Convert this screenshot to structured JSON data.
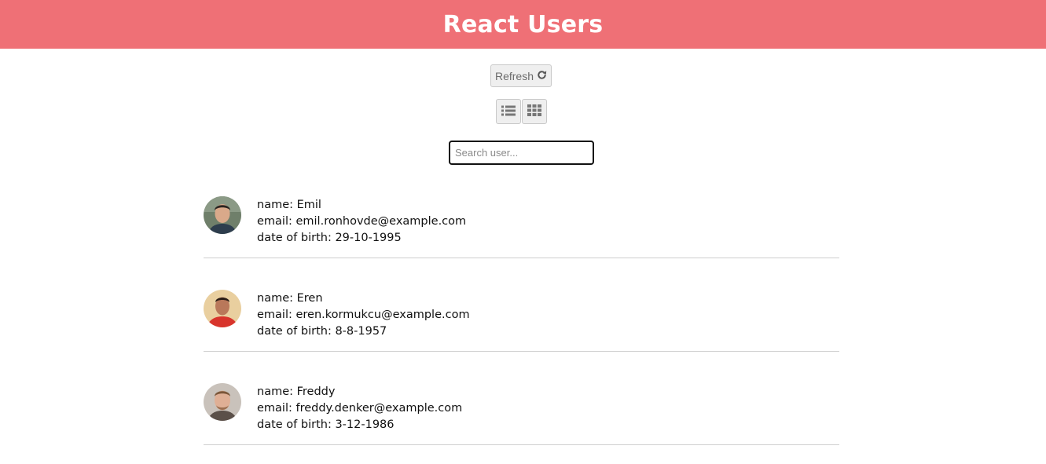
{
  "header": {
    "title": "React Users"
  },
  "controls": {
    "refresh_label": "Refresh",
    "refresh_icon": "refresh-icon",
    "list_view_icon": "list-view-icon",
    "grid_view_icon": "grid-view-icon",
    "search_placeholder": "Search user..."
  },
  "colors": {
    "header_bg": "#ef7076",
    "header_text": "#ffffff",
    "divider": "#cfcfcf"
  },
  "users": [
    {
      "name_text": "name: Emil",
      "email_text": "email: emil.ronhovde@example.com",
      "dob_text": "date of birth: 29-10-1995"
    },
    {
      "name_text": "name: Eren",
      "email_text": "email: eren.kormukcu@example.com",
      "dob_text": "date of birth: 8-8-1957"
    },
    {
      "name_text": "name: Freddy",
      "email_text": "email: freddy.denker@example.com",
      "dob_text": "date of birth: 3-12-1986"
    }
  ]
}
